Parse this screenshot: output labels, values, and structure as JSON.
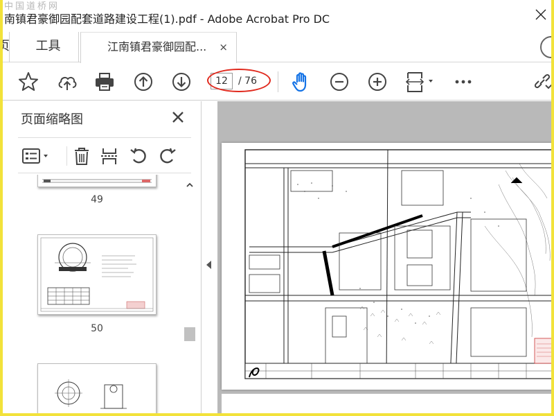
{
  "window": {
    "title": "南镇君豪御园配套道路建设工程(1).pdf - Adobe Acrobat Pro DC",
    "watermark": "中国道桥网"
  },
  "tabs": {
    "home_label": "页",
    "tools_label": "工具",
    "doc_label": "江南镇君豪御园配...",
    "doc_close": "×"
  },
  "toolbar": {
    "current_page": "12",
    "total_pages": "/ 76",
    "more": "•••"
  },
  "sidebar": {
    "title": "页面缩略图",
    "thumbnails": [
      {
        "label": "49"
      },
      {
        "label": "50"
      },
      {
        "label": ""
      }
    ]
  },
  "colors": {
    "highlight_oval": "#e0291d",
    "frame": "#f2e23a",
    "hand_tool": "#1473e6",
    "doc_background": "#b9b9b9"
  },
  "icons": [
    "bookmark-star-icon",
    "upload-cloud-icon",
    "print-icon",
    "page-up-icon",
    "page-down-icon",
    "hand-tool-icon",
    "zoom-out-icon",
    "zoom-in-icon",
    "fit-page-icon",
    "more-icon",
    "share-link-icon"
  ]
}
